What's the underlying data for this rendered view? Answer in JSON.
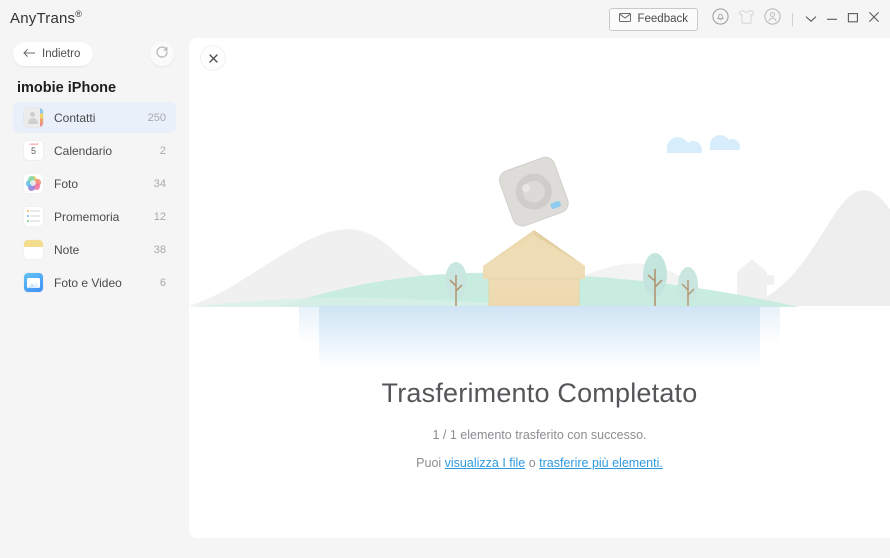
{
  "window": {
    "title": "AnyTrans",
    "title_mark": "®",
    "controls": {
      "feedback_label": "Feedback",
      "feedback_icon": "envelope-icon",
      "notification_icon": "bell-icon",
      "skin_icon": "tshirt-icon",
      "account_icon": "user-icon",
      "menu_icon": "chevron-down-icon",
      "minimize_icon": "minimize-icon",
      "maximize_icon": "maximize-icon",
      "close_icon": "close-icon"
    }
  },
  "sidebar": {
    "back_label": "Indietro",
    "back_icon": "arrow-left-icon",
    "refresh_icon": "refresh-icon",
    "device_name": "imobie iPhone",
    "items": [
      {
        "label": "Contatti",
        "count": "250",
        "icon": "contacts-icon",
        "selected": true
      },
      {
        "label": "Calendario",
        "count": "2",
        "icon": "calendar-icon",
        "calendar_month": "martedi",
        "calendar_day": "5",
        "selected": false
      },
      {
        "label": "Foto",
        "count": "34",
        "icon": "photos-icon",
        "selected": false
      },
      {
        "label": "Promemoria",
        "count": "12",
        "icon": "reminders-icon",
        "selected": false
      },
      {
        "label": "Note",
        "count": "38",
        "icon": "notes-icon",
        "selected": false
      },
      {
        "label": "Foto e Video",
        "count": "6",
        "icon": "media-icon",
        "selected": false
      }
    ]
  },
  "content": {
    "close_icon": "close-icon",
    "illustration": "transfer-complete-landscape-box",
    "heading": "Trasferimento Completato",
    "subtitle": "1 / 1 elemento trasferito con successo.",
    "action_prefix": "Puoi ",
    "link_view_files": "visualizza I file",
    "action_separator": " o ",
    "link_transfer_more": "trasferire più elementi."
  },
  "colors": {
    "window_bg": "#f5f5f6",
    "panel_bg": "#ffffff",
    "selected_item_bg": "#e9f0fa",
    "link": "#2f9ae0",
    "heading_text": "#55565a",
    "muted_text": "#8d8d92"
  }
}
